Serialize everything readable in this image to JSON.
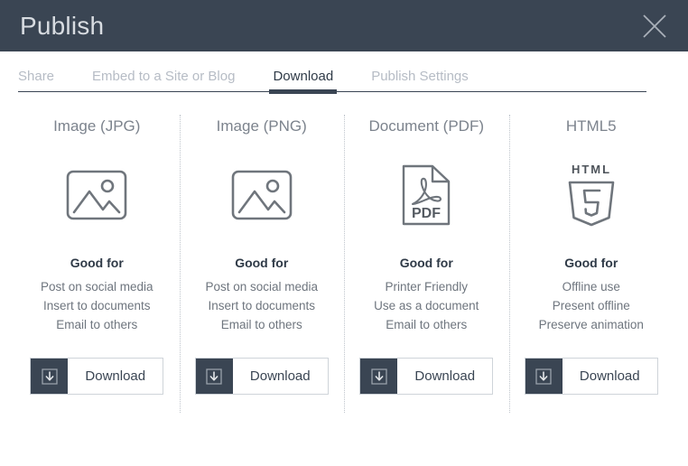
{
  "header": {
    "title": "Publish",
    "close_icon": "close-icon",
    "background": "#3a4553",
    "title_color": "#d8dce1"
  },
  "tabs": [
    {
      "label": "Share",
      "active": false
    },
    {
      "label": "Embed to a Site or Blog",
      "active": false
    },
    {
      "label": "Download",
      "active": true
    },
    {
      "label": "Publish Settings",
      "active": false
    }
  ],
  "cards": [
    {
      "title": "Image (JPG)",
      "icon": "image-icon",
      "good_for_label": "Good for",
      "benefits": [
        "Post on social media",
        "Insert to documents",
        "Email to others"
      ],
      "button_label": "Download",
      "button_icon": "download-icon"
    },
    {
      "title": "Image (PNG)",
      "icon": "image-icon",
      "good_for_label": "Good for",
      "benefits": [
        "Post on social media",
        "Insert to documents",
        "Email to others"
      ],
      "button_label": "Download",
      "button_icon": "download-icon"
    },
    {
      "title": "Document (PDF)",
      "icon": "pdf-file-icon",
      "icon_text": "PDF",
      "good_for_label": "Good for",
      "benefits": [
        "Printer Friendly",
        "Use as a document",
        "Email to others"
      ],
      "button_label": "Download",
      "button_icon": "download-icon"
    },
    {
      "title": "HTML5",
      "icon": "html5-shield-icon",
      "icon_text_top": "HTML",
      "icon_text_inner": "5",
      "good_for_label": "Good for",
      "benefits": [
        "Offline use",
        "Present offline",
        "Preserve animation"
      ],
      "button_label": "Download",
      "button_icon": "download-icon"
    }
  ],
  "colors": {
    "accent_dark": "#3a4553",
    "muted_text": "#b6bcc5",
    "body_text": "#6e757e",
    "icon_stroke": "#6f757c"
  }
}
